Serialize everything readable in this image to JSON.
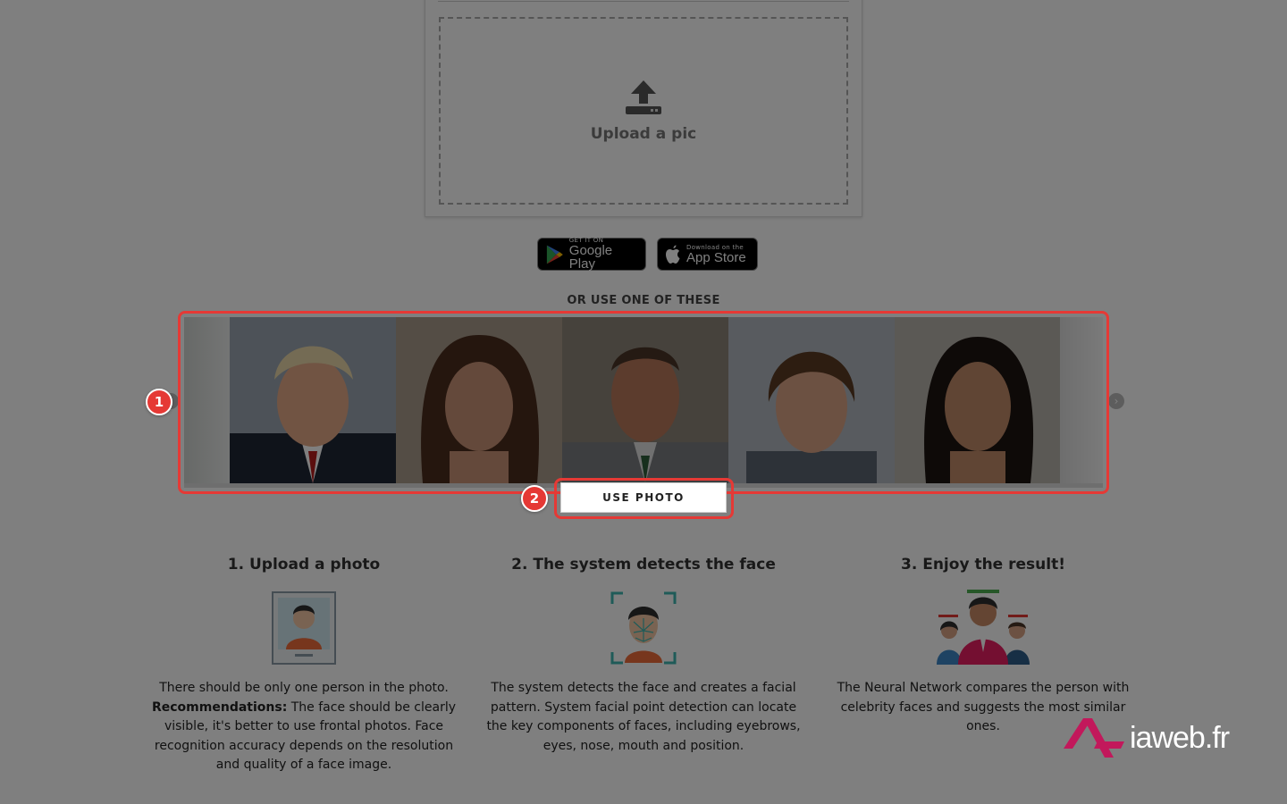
{
  "upload": {
    "label": "Upload a pic"
  },
  "stores": {
    "google": {
      "small": "GET IT ON",
      "big": "Google Play"
    },
    "apple": {
      "small": "Download on the",
      "big": "App Store"
    }
  },
  "samples": {
    "heading": "OR USE ONE OF THESE",
    "use_button": "USE PHOTO",
    "faces": [
      "sample-face-1",
      "sample-face-2",
      "sample-face-3",
      "sample-face-4",
      "sample-face-5"
    ]
  },
  "annotations": {
    "marker1": "1",
    "marker2": "2",
    "accent_color": "#e53935"
  },
  "steps": [
    {
      "title": "1. Upload a photo",
      "p1": "There should be only one person in the photo.",
      "bold": "Recommendations:",
      "p2": " The face should be clearly visible, it's better to use frontal photos. Face recognition accuracy depends on the resolution and quality of a face image."
    },
    {
      "title": "2. The system detects the face",
      "text": "The system detects the face and creates a facial pattern. System facial point detection can locate the key components of faces, including eyebrows, eyes, nose, mouth and position."
    },
    {
      "title": "3. Enjoy the result!",
      "text": "The Neural Network compares the person with celebrity faces and suggests the most similar ones."
    }
  ],
  "watermark": {
    "text": "iaweb.fr",
    "brand_color": "#c2185b"
  }
}
